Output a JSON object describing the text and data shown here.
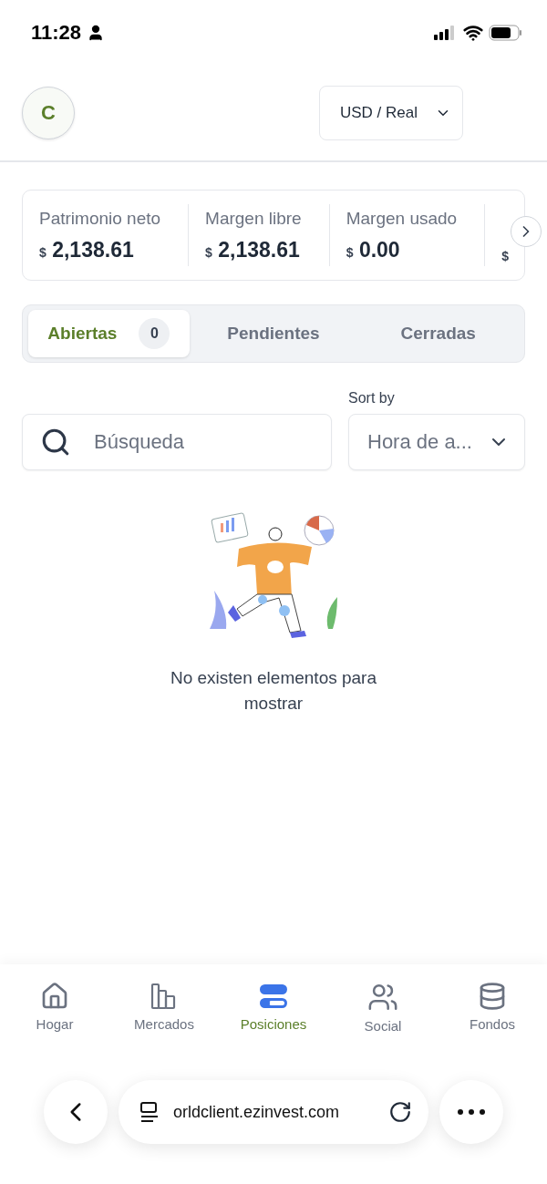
{
  "status_bar": {
    "time": "11:28"
  },
  "header": {
    "avatar": "C",
    "account_select": "USD / Real"
  },
  "stats": [
    {
      "label": "Patrimonio neto",
      "currency": "$",
      "value": "2,138.61"
    },
    {
      "label": "Margen libre",
      "currency": "$",
      "value": "2,138.61"
    },
    {
      "label": "Margen usado",
      "currency": "$",
      "value": "0.00"
    },
    {
      "currency": "$"
    }
  ],
  "tabs": [
    {
      "label": "Abiertas",
      "count": "0",
      "selected": true
    },
    {
      "label": "Pendientes",
      "selected": false
    },
    {
      "label": "Cerradas",
      "selected": false
    }
  ],
  "search": {
    "placeholder": "Búsqueda"
  },
  "sort": {
    "label": "Sort by",
    "value": "Hora de a..."
  },
  "empty_state": {
    "message": "No existen elementos para mostrar"
  },
  "nav": [
    {
      "label": "Hogar",
      "kind": "home",
      "selected": false
    },
    {
      "label": "Mercados",
      "kind": "markets",
      "selected": false
    },
    {
      "label": "Posiciones",
      "kind": "positions",
      "selected": true
    },
    {
      "label": "Social",
      "kind": "social",
      "selected": false
    },
    {
      "label": "Fondos",
      "kind": "funds",
      "selected": false
    }
  ],
  "browser": {
    "url": "orldclient.ezinvest.com"
  }
}
